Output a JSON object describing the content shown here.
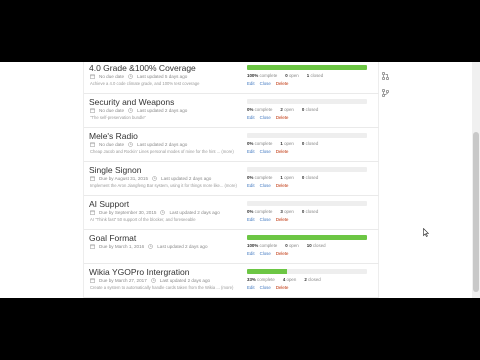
{
  "milestones": [
    {
      "title": "4.0 Grade &100% Coverage",
      "meta": [
        "No due date",
        "Last updated 5 days ago"
      ],
      "description": "Achieve a 4.0 code climate grade, and 100% test coverage",
      "progress": 1.0,
      "stats": {
        "percent": "100%",
        "percent_label": "complete",
        "open": "0",
        "open_label": "open",
        "closed": "1",
        "closed_label": "closed"
      },
      "actions": {
        "edit": "Edit",
        "close": "Close",
        "delete": "Delete"
      }
    },
    {
      "title": "Security and Weapons",
      "meta": [
        "No due date",
        "Last updated 2 days ago"
      ],
      "description": "\"The self-preservation bundle\"",
      "progress": 0.0,
      "stats": {
        "percent": "0%",
        "percent_label": "complete",
        "open": "2",
        "open_label": "open",
        "closed": "0",
        "closed_label": "closed"
      },
      "actions": {
        "edit": "Edit",
        "close": "Close",
        "delete": "Delete"
      }
    },
    {
      "title": "Mele's Radio",
      "meta": [
        "No due date",
        "Last updated 2 days ago"
      ],
      "description": "Cheap Jacob and Rockin' Lines personal modes of mine for the hint ... (more)",
      "progress": 0.0,
      "stats": {
        "percent": "0%",
        "percent_label": "complete",
        "open": "1",
        "open_label": "open",
        "closed": "0",
        "closed_label": "closed"
      },
      "actions": {
        "edit": "Edit",
        "close": "Close",
        "delete": "Delete"
      }
    },
    {
      "title": "Single Signon",
      "meta": [
        "Due by August 31, 2015",
        "Last updated 2 days ago"
      ],
      "description": "Implement the Aron Jiangfeng Bar system, using it for things more like... (more)",
      "progress": 0.0,
      "stats": {
        "percent": "0%",
        "percent_label": "complete",
        "open": "1",
        "open_label": "open",
        "closed": "0",
        "closed_label": "closed"
      },
      "actions": {
        "edit": "Edit",
        "close": "Close",
        "delete": "Delete"
      }
    },
    {
      "title": "AI Support",
      "meta": [
        "Due by September 30, 2015",
        "Last updated 2 days ago"
      ],
      "description": "AI \"Think fast\" 50 support of the blocker, and foreseeable",
      "progress": 0.0,
      "stats": {
        "percent": "0%",
        "percent_label": "complete",
        "open": "3",
        "open_label": "open",
        "closed": "0",
        "closed_label": "closed"
      },
      "actions": {
        "edit": "Edit",
        "close": "Close",
        "delete": "Delete"
      }
    },
    {
      "title": "Goal Format",
      "meta": [
        "Due by March 1, 2016",
        "Last updated 2 days ago"
      ],
      "description": "",
      "progress": 1.0,
      "stats": {
        "percent": "100%",
        "percent_label": "complete",
        "open": "0",
        "open_label": "open",
        "closed": "10",
        "closed_label": "closed"
      },
      "actions": {
        "edit": "Edit",
        "close": "Close",
        "delete": "Delete"
      }
    },
    {
      "title": "Wikia YGOPro Intergration",
      "meta": [
        "Due by March 27, 2017",
        "Last updated 2 days ago"
      ],
      "description": "Create a system to automatically handle cards taken from the Wikia ... (more)",
      "progress": 0.33,
      "stats": {
        "percent": "33%",
        "percent_label": "complete",
        "open": "4",
        "open_label": "open",
        "closed": "2",
        "closed_label": "closed"
      },
      "actions": {
        "edit": "Edit",
        "close": "Close",
        "delete": "Delete"
      }
    }
  ],
  "side_icons": [
    "pull-request-icon",
    "git-branch-icon"
  ],
  "colors": {
    "progress_fill": "#6cc644",
    "link": "#4078c0",
    "delete": "#bd2c00"
  }
}
